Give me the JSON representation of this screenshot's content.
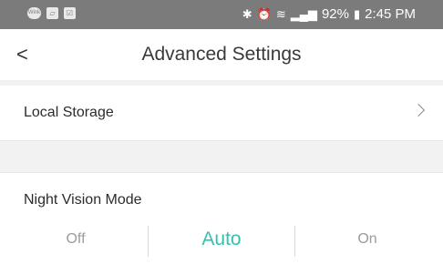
{
  "status_bar": {
    "left_icons": [
      {
        "name": "app-badge-icon",
        "glyph": "Wink"
      },
      {
        "name": "app-graph-icon",
        "glyph": "▱"
      },
      {
        "name": "checkbox-app-icon",
        "glyph": "☑"
      }
    ],
    "bluetooth_glyph": "✱",
    "alarm_glyph": "⏰",
    "wifi_glyph": "≋",
    "signal_glyph": "▂▄▆",
    "battery": "92%",
    "battery_glyph": "▮",
    "time": "2:45 PM"
  },
  "header": {
    "back_glyph": "<",
    "title": "Advanced Settings"
  },
  "settings": {
    "local_storage_label": "Local Storage",
    "night_vision_label": "Night Vision Mode",
    "night_vision_options": [
      "Off",
      "Auto",
      "On"
    ],
    "night_vision_selected": "Auto"
  },
  "colors": {
    "accent": "#33c2b0",
    "status_bar": "#7b7b7b",
    "section_gap": "#f2f2f2"
  }
}
